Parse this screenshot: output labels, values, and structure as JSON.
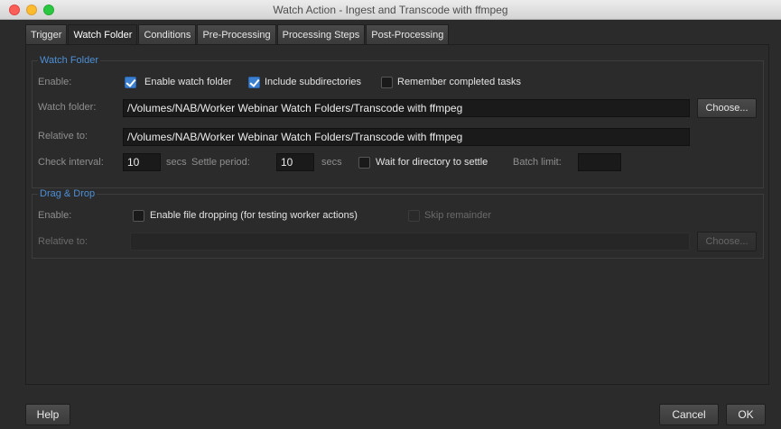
{
  "window": {
    "title": "Watch Action - Ingest and Transcode with ffmpeg"
  },
  "tabs": [
    {
      "label": "Trigger"
    },
    {
      "label": "Watch Folder",
      "active": true
    },
    {
      "label": "Conditions"
    },
    {
      "label": "Pre-Processing"
    },
    {
      "label": "Processing Steps"
    },
    {
      "label": "Post-Processing"
    }
  ],
  "watch_folder": {
    "group_title": "Watch Folder",
    "enable_label": "Enable:",
    "enable_watch_folder": {
      "label": "Enable watch folder",
      "checked": true
    },
    "include_subdirectories": {
      "label": "Include subdirectories",
      "checked": true
    },
    "remember_completed": {
      "label": "Remember completed tasks",
      "checked": false
    },
    "watch_folder_label": "Watch folder:",
    "watch_folder_value": "/Volumes/NAB/Worker Webinar Watch Folders/Transcode with ffmpeg",
    "choose_label": "Choose...",
    "relative_to_label": "Relative to:",
    "relative_to_value": "/Volumes/NAB/Worker Webinar Watch Folders/Transcode with ffmpeg",
    "check_interval_label": "Check interval:",
    "check_interval_value": "10",
    "secs_label": "secs",
    "settle_period_label": "Settle period:",
    "settle_period_value": "10",
    "wait_for_directory": {
      "label": "Wait for directory to settle",
      "checked": false
    },
    "batch_limit_label": "Batch limit:",
    "batch_limit_value": ""
  },
  "drag_drop": {
    "group_title": "Drag & Drop",
    "enable_label": "Enable:",
    "enable_file_dropping": {
      "label": "Enable file dropping (for testing worker actions)",
      "checked": false
    },
    "skip_remainder": {
      "label": "Skip remainder",
      "checked": false,
      "disabled": true
    },
    "relative_to_label": "Relative to:",
    "relative_to_value": "",
    "choose_label": "Choose..."
  },
  "footer": {
    "help_label": "Help",
    "cancel_label": "Cancel",
    "ok_label": "OK"
  }
}
